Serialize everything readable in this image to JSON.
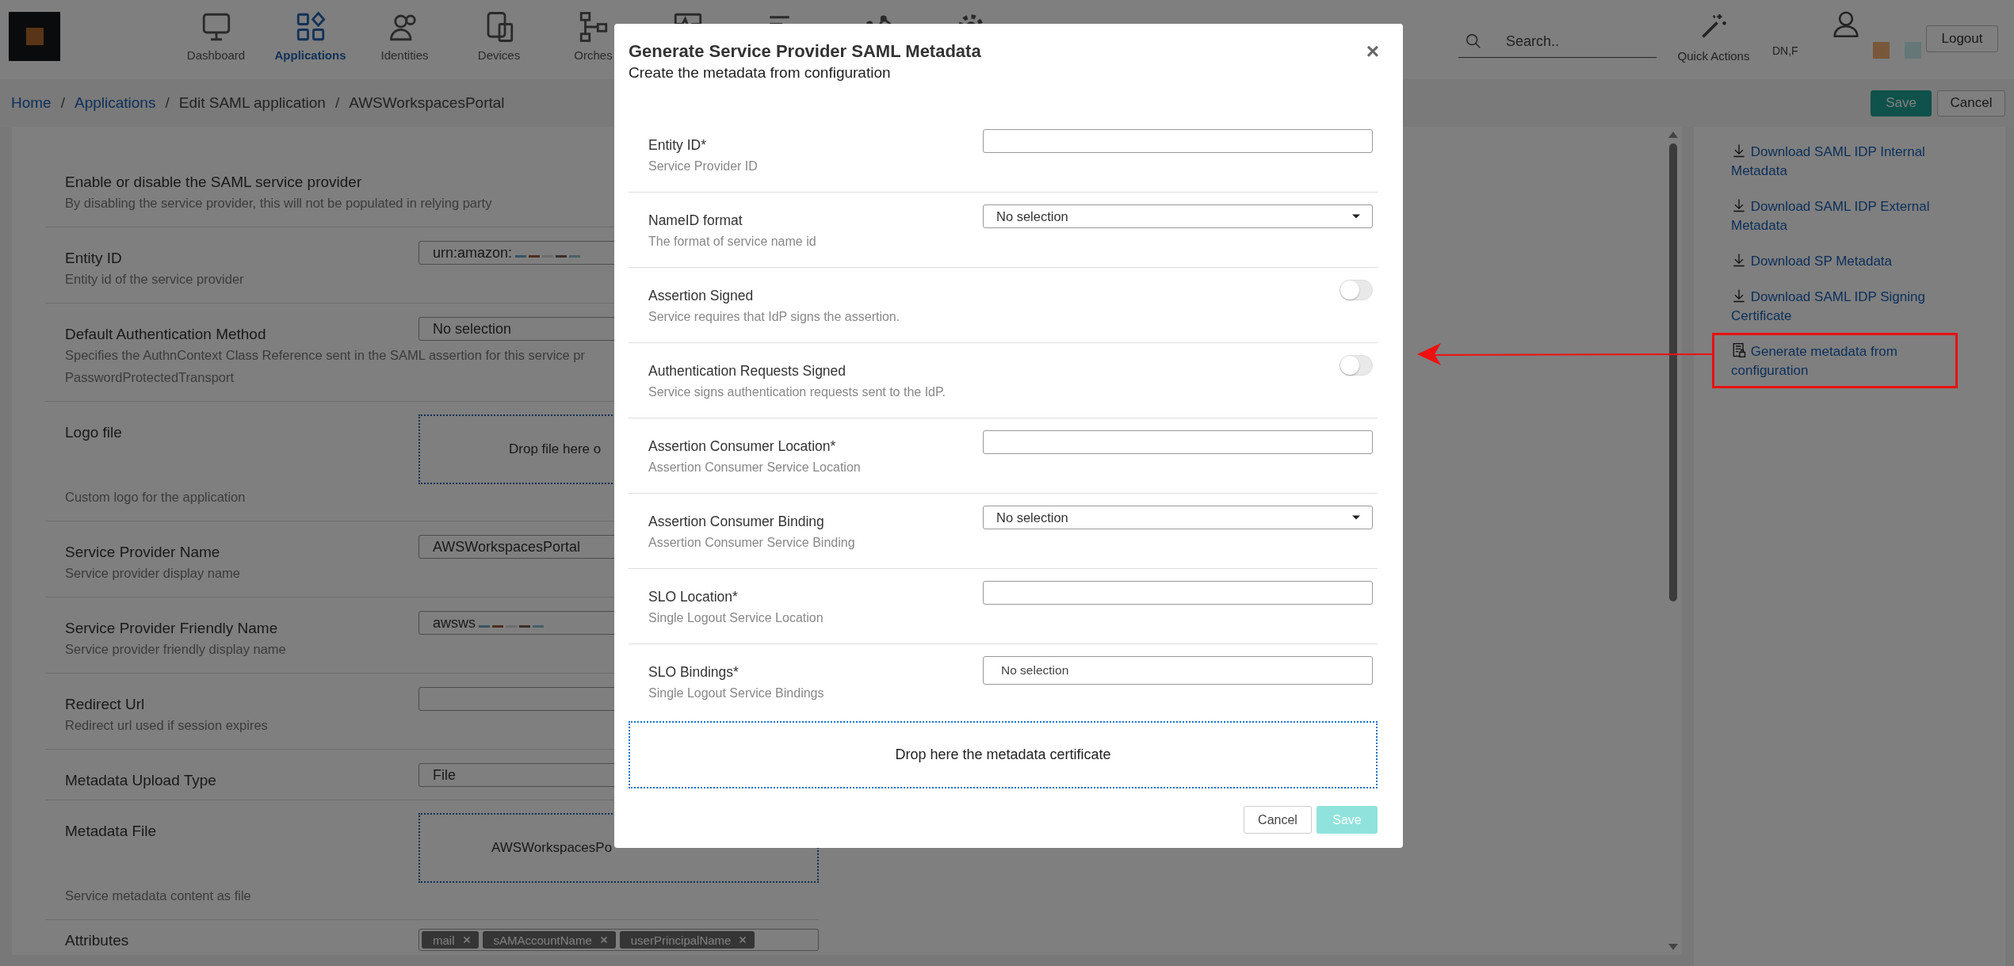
{
  "header": {
    "nav": [
      {
        "label": "Dashboard",
        "selected": false
      },
      {
        "label": "Applications",
        "selected": true
      },
      {
        "label": "Identities",
        "selected": false
      },
      {
        "label": "Devices",
        "selected": false
      },
      {
        "label": "Orches",
        "selected": false
      },
      {
        "selected": false
      },
      {
        "selected": false
      },
      {
        "selected": false
      },
      {
        "selected": false
      }
    ],
    "search": {
      "placeholder": "Search.."
    },
    "quick_actions": {
      "label": "Quick Actions"
    },
    "user": {
      "name": "DN,F"
    },
    "logout": "Logout"
  },
  "breadcrumb": [
    {
      "label": "Home",
      "link": true
    },
    {
      "separator": "/",
      "label": "Applications",
      "link": true
    },
    {
      "separator": "/",
      "label": "Edit SAML application",
      "link": false
    },
    {
      "separator": "/",
      "label": "AWSWorkspacesPortal",
      "link": false
    }
  ],
  "page_actions": {
    "save": {
      "label": "Save",
      "disabled": false
    },
    "cancel": "Cancel"
  },
  "form": {
    "rows": [
      {
        "kind": "plain",
        "label": "Enable or disable the SAML service provider",
        "description": "By disabling the service provider, this will not be populated in relying party"
      },
      {
        "kind": "input",
        "label": "Entity ID",
        "description": "Entity id of the service provider",
        "value": "urn:amazon:",
        "redacted": true
      },
      {
        "kind": "select",
        "label": "Default Authentication Method",
        "description": "Specifies the AuthnContext Class Reference sent in the SAML assertion for this service pr",
        "note": "PasswordProtectedTransport",
        "value": "No selection"
      },
      {
        "kind": "dropzone",
        "label": "Logo file",
        "description": "Custom logo for the application",
        "value": "Drop file here o"
      },
      {
        "kind": "input",
        "label": "Service Provider Name",
        "description": "Service provider display name",
        "value": "AWSWorkspacesPortal"
      },
      {
        "kind": "input",
        "label": "Service Provider Friendly Name",
        "description": "Service provider friendly display name",
        "value": "awsws",
        "redacted": true
      },
      {
        "kind": "input",
        "label": "Redirect Url",
        "description": "Redirect url used if session expires"
      },
      {
        "kind": "select",
        "label": "Metadata Upload Type",
        "value": "File"
      },
      {
        "kind": "dropzone",
        "label": "Metadata File",
        "description": "Service metadata content as file",
        "value": "AWSWorkspacesPo"
      },
      {
        "kind": "tags",
        "label": "Attributes",
        "tags": [
          "mail",
          "sAMAccountName",
          "userPrincipalName"
        ]
      }
    ]
  },
  "links": [
    {
      "kind": "download",
      "label": "Download SAML IDP Internal Metadata",
      "highlighted": false
    },
    {
      "kind": "download",
      "label": "Download SAML IDP External Metadata",
      "highlighted": false
    },
    {
      "kind": "download",
      "label": "Download SP Metadata",
      "highlighted": false
    },
    {
      "kind": "download",
      "label": "Download SAML IDP Signing Certificate",
      "highlighted": false
    },
    {
      "kind": "document",
      "label": "Generate metadata from configuration",
      "highlighted": true
    }
  ],
  "dialog": {
    "title": "Generate Service Provider SAML Metadata",
    "subtitle": "Create the metadata from configuration",
    "close": "×",
    "fields": [
      {
        "kind": "input",
        "label": "Entity ID*",
        "description": "Service Provider ID"
      },
      {
        "kind": "select",
        "label": "NameID format",
        "description": "The format of service name id",
        "value": "No selection"
      },
      {
        "kind": "toggle",
        "label": "Assertion Signed",
        "description": "Service requires that IdP signs the assertion.",
        "on": false
      },
      {
        "kind": "toggle",
        "label": "Authentication Requests Signed",
        "description": "Service signs authentication requests sent to the IdP.",
        "on": false
      },
      {
        "kind": "input",
        "label": "Assertion Consumer Location*",
        "description": "Assertion Consumer Service Location"
      },
      {
        "kind": "select",
        "label": "Assertion Consumer Binding",
        "description": "Assertion Consumer Service Binding",
        "value": "No selection"
      },
      {
        "kind": "input",
        "label": "SLO Location*",
        "description": "Single Logout Service Location"
      },
      {
        "kind": "multiselect",
        "label": "SLO Bindings*",
        "description": "Single Logout Service Bindings",
        "placeholder": "No selection"
      }
    ],
    "dropzone": "Drop here the metadata certificate",
    "cancel": "Cancel",
    "save": {
      "label": "Save",
      "disabled": true
    }
  }
}
